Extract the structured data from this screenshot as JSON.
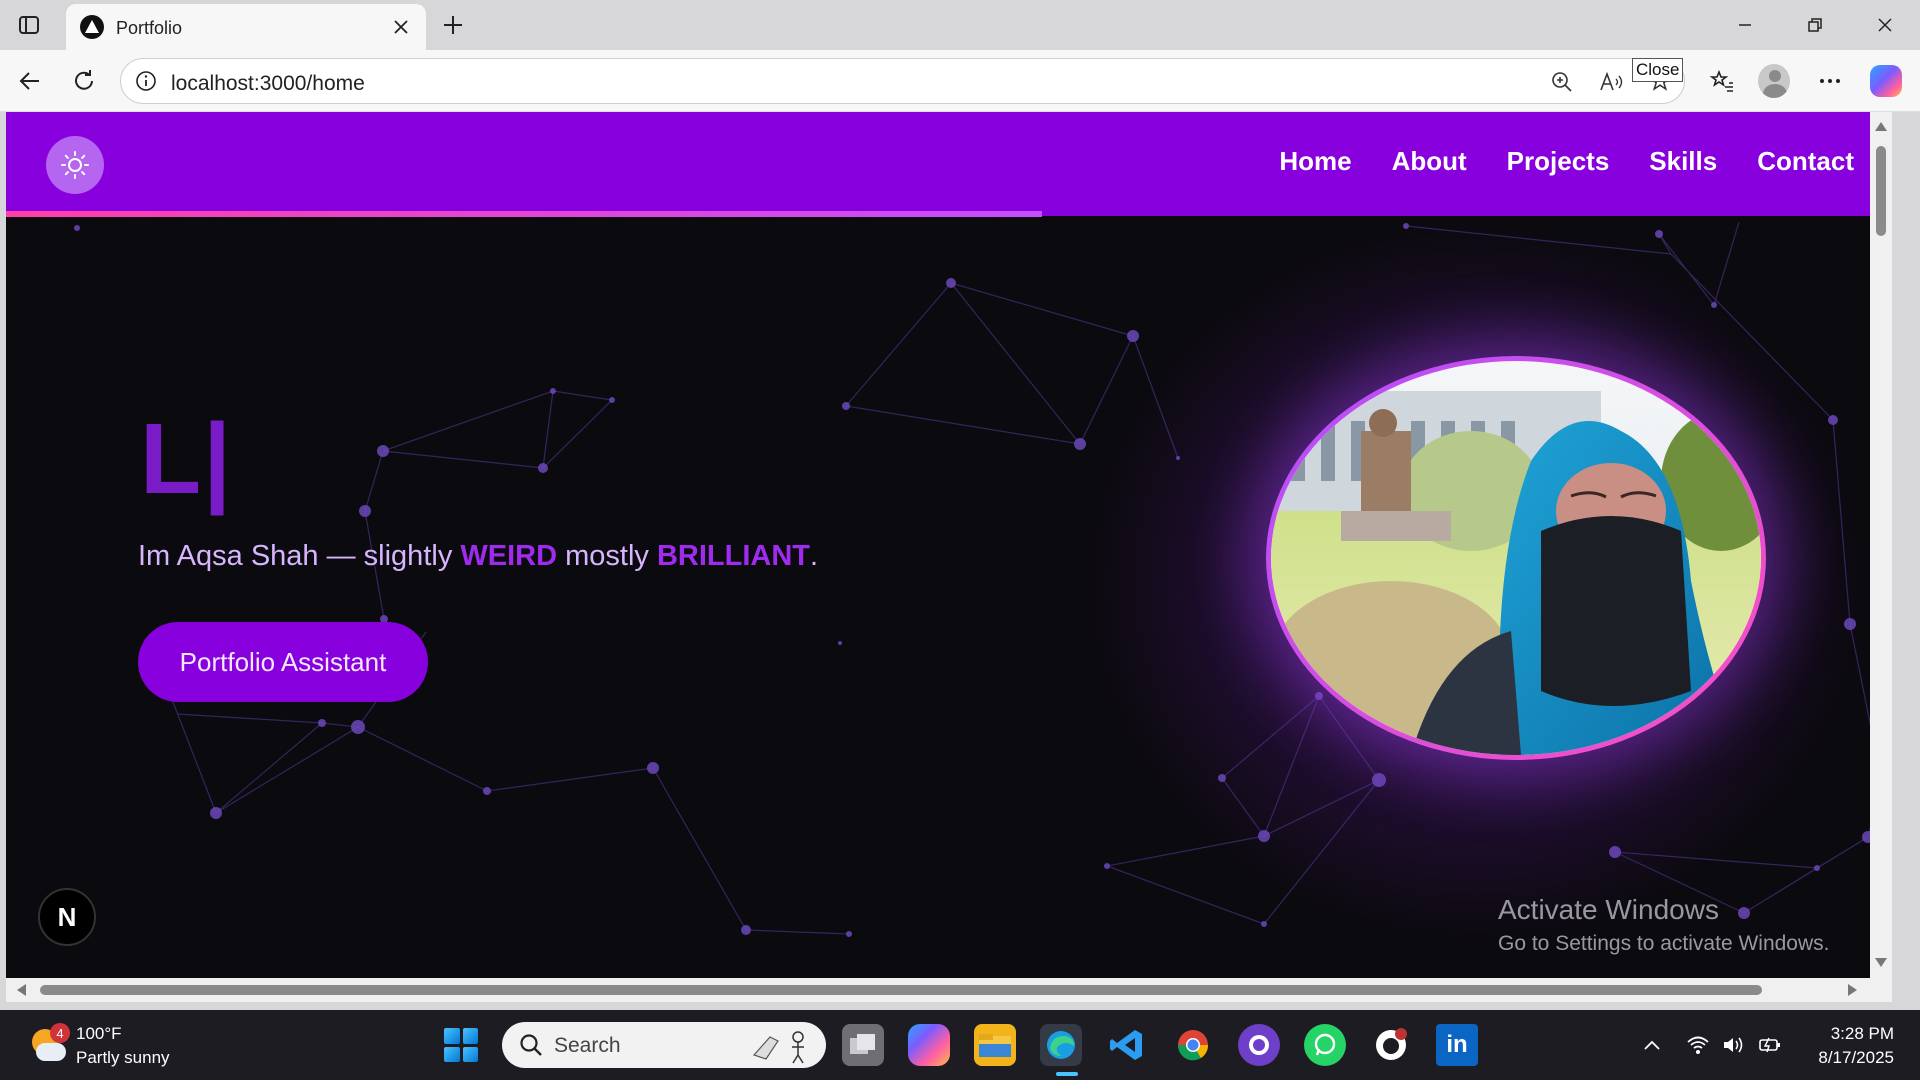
{
  "browser": {
    "tab_title": "Portfolio",
    "url": "localhost:3000/home",
    "tooltip": "Close"
  },
  "site": {
    "nav": [
      "Home",
      "About",
      "Projects",
      "Skills",
      "Contact"
    ],
    "typing_text": "L|",
    "tagline": {
      "prefix": "Im Aqsa Shah — slightly ",
      "word1": "WEIRD",
      "middle": " mostly ",
      "word2": "BRILLIANT",
      "suffix": "."
    },
    "cta": "Portfolio Assistant",
    "next_badge": "N",
    "colors": {
      "brand": "#8800dd",
      "accent": "#a02bf0",
      "ring": "#c44dff"
    }
  },
  "watermark": {
    "title": "Activate Windows",
    "subtitle": "Go to Settings to activate Windows."
  },
  "taskbar": {
    "weather_temp": "100°F",
    "weather_desc": "Partly sunny",
    "weather_badge": "4",
    "search_placeholder": "Search",
    "time": "3:28 PM",
    "date": "8/17/2025"
  }
}
